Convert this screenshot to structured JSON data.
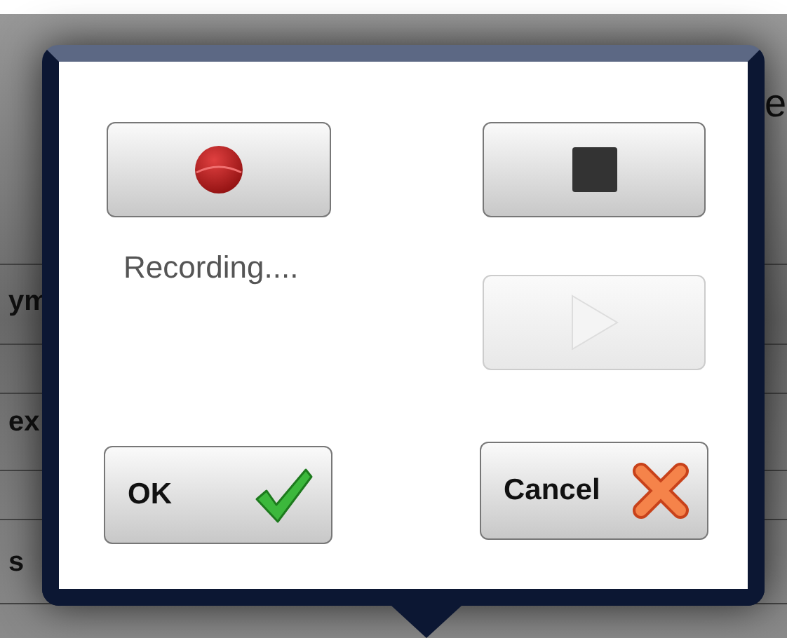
{
  "background": {
    "fragments": [
      {
        "text": "e",
        "kind": "heading"
      },
      {
        "text": "ym",
        "kind": "row"
      },
      {
        "text": "ex",
        "kind": "row"
      },
      {
        "text": "s",
        "kind": "row"
      }
    ]
  },
  "popover": {
    "controls": [
      {
        "kind": "record",
        "disabled": false
      },
      {
        "kind": "stop",
        "disabled": false
      },
      {
        "kind": "play",
        "disabled": true
      }
    ],
    "status": "Recording....",
    "buttons": [
      {
        "kind": "ok",
        "label": "OK"
      },
      {
        "kind": "cancel",
        "label": "Cancel"
      }
    ]
  }
}
